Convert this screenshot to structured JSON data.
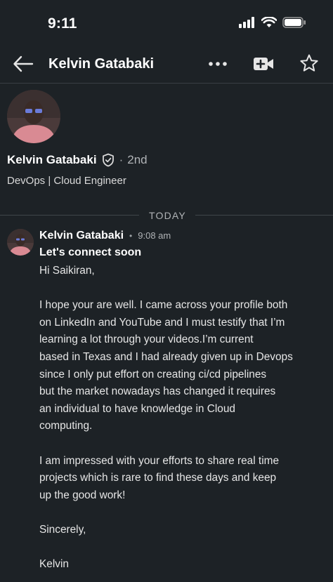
{
  "status": {
    "time": "9:11"
  },
  "header": {
    "title": "Kelvin Gatabaki"
  },
  "profile": {
    "name": "Kelvin Gatabaki",
    "degree": "2nd",
    "headline": "DevOps | Cloud Engineer"
  },
  "divider": {
    "label": "TODAY"
  },
  "message": {
    "sender": "Kelvin Gatabaki",
    "time": "9:08 am",
    "subject": "Let's connect soon",
    "lines": [
      "Hi Saikiran,",
      "",
      "I hope your are well. I came across your profile both",
      "on LinkedIn and YouTube and I must testify that I’m",
      "learning a lot  through your videos.I’m current",
      "based in Texas and I had already given up in Devops",
      "since I only put effort  on creating ci/cd pipelines",
      "but the market nowadays has changed it requires",
      "an individual to have knowledge in Cloud",
      "computing.",
      "",
      "I am impressed with your efforts to share real time",
      "projects which is rare to find these days and keep",
      "up the good work!",
      "",
      "Sincerely,",
      "",
      "Kelvin"
    ]
  },
  "icons": {
    "back": "back-arrow-icon",
    "more": "more-options-icon",
    "video": "video-call-icon",
    "star": "star-icon",
    "verified": "verified-shield-icon"
  }
}
